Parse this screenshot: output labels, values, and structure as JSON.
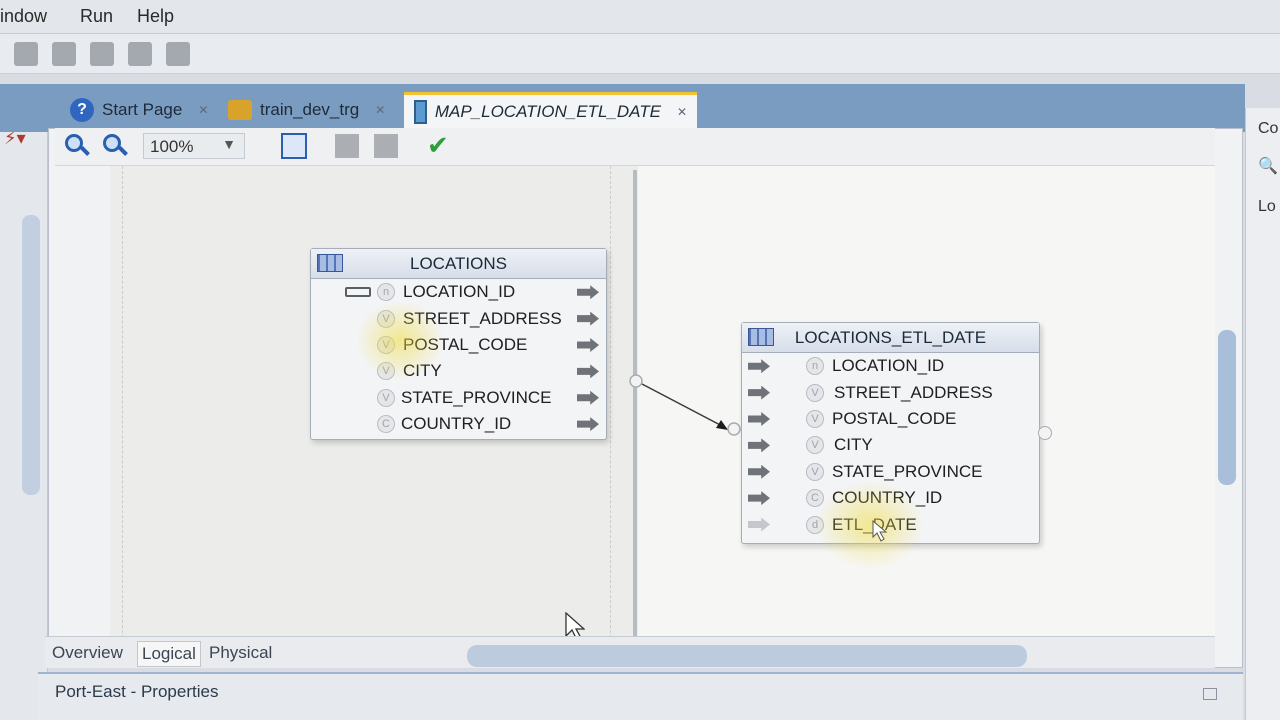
{
  "menu": {
    "items": [
      "indow",
      "Run",
      "Help"
    ]
  },
  "tabs": [
    {
      "label": "Start Page",
      "icon": "help-icon"
    },
    {
      "label": "train_dev_trg",
      "icon": "folder-icon"
    },
    {
      "label": "MAP_LOCATION_ETL_DATE",
      "icon": "map-icon",
      "active": true
    }
  ],
  "editor_toolbar": {
    "zoom": "100%"
  },
  "source_entity": {
    "title": "LOCATIONS",
    "columns": [
      {
        "badge": "n",
        "name": "LOCATION_ID",
        "key": true
      },
      {
        "badge": "V",
        "name": "STREET_ADDRESS"
      },
      {
        "badge": "V",
        "name": "POSTAL_CODE"
      },
      {
        "badge": "V",
        "name": "CITY"
      },
      {
        "badge": "V",
        "name": "STATE_PROVINCE"
      },
      {
        "badge": "C",
        "name": "COUNTRY_ID"
      }
    ]
  },
  "target_entity": {
    "title": "LOCATIONS_ETL_DATE",
    "columns": [
      {
        "badge": "n",
        "name": "LOCATION_ID"
      },
      {
        "badge": "V",
        "name": "STREET_ADDRESS"
      },
      {
        "badge": "V",
        "name": "POSTAL_CODE"
      },
      {
        "badge": "V",
        "name": "CITY"
      },
      {
        "badge": "V",
        "name": "STATE_PROVINCE"
      },
      {
        "badge": "C",
        "name": "COUNTRY_ID"
      },
      {
        "badge": "d",
        "name": "ETL_DATE",
        "unmapped": true
      }
    ]
  },
  "bottom_tabs": [
    "Overview",
    "Logical",
    "Physical"
  ],
  "properties": {
    "title": "Port-East - Properties"
  },
  "right_pane": {
    "label_top": "Co",
    "label_mid": "Lo"
  },
  "colors": {
    "tab_strip": "#7b9cc1",
    "active_tab_accent": "#f1c232",
    "check": "#2e9e3a"
  }
}
